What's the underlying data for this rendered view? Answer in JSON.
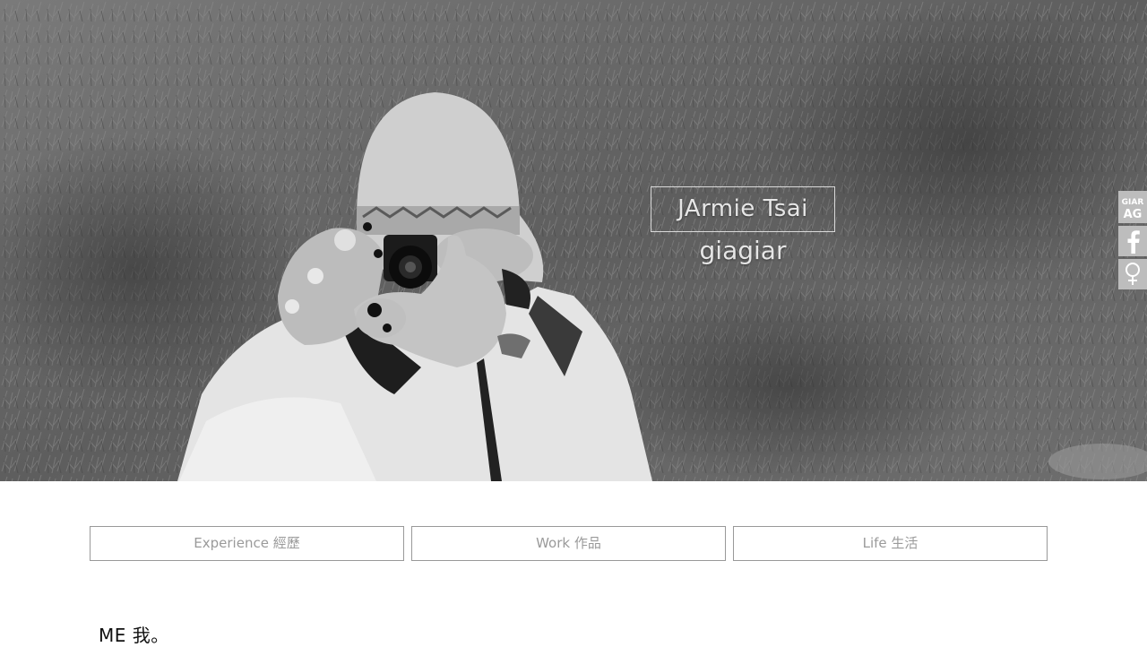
{
  "hero": {
    "name": "JArmie Tsai",
    "subtitle": "giagiar"
  },
  "social": [
    {
      "icon": "giagiar-logo-icon",
      "label": "GIAR"
    },
    {
      "icon": "facebook-icon",
      "label": "f"
    },
    {
      "icon": "venus-symbol-icon",
      "label": "♀"
    }
  ],
  "nav": {
    "experience": "Experience 經歷",
    "work": "Work 作品",
    "life": "Life 生活"
  },
  "section": {
    "title": "ME 我。"
  }
}
